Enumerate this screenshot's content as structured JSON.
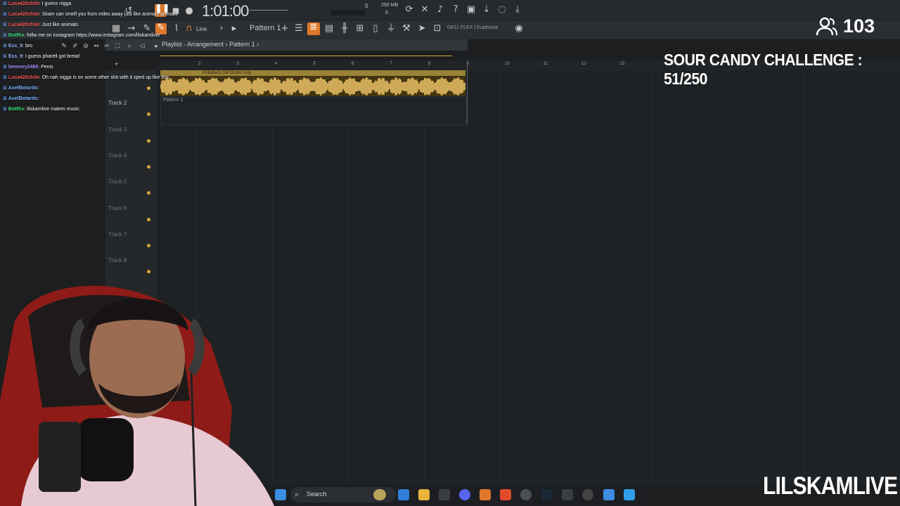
{
  "toolbar": {
    "time": "1:01:00",
    "memory": "250 MB",
    "memory_sub": "0",
    "counter_left": "0",
    "tool_line": "Line",
    "pattern": "Pattern 1",
    "plugin_info": "09/11  FLEX | Euphonia"
  },
  "playlist": {
    "title": "Playlist - Arrangement",
    "breadcrumb_sep": "›",
    "pattern_crumb": "Pattern 1",
    "ruler": [
      "2",
      "3",
      "4",
      "5",
      "6",
      "7",
      "8",
      "9",
      "10",
      "11",
      "12",
      "13"
    ],
    "tracks": [
      {
        "label": ""
      },
      {
        "label": "Track 2"
      },
      {
        "label": "Track 3"
      },
      {
        "label": "Track 4"
      },
      {
        "label": "Track 5"
      },
      {
        "label": "Track 6"
      },
      {
        "label": "Track 7"
      },
      {
        "label": "Track 8"
      }
    ],
    "audio_clip_name": "Hollaback Girl Drums only",
    "pattern_clip_name": "Pattern 1"
  },
  "chat": [
    {
      "user": "Luca420chile",
      "msg": ": I guess nigga",
      "color": "#ff5a5a"
    },
    {
      "user": "Luca420chile",
      "msg": ": Skam can smell you from miles away just like animals animals",
      "color": "#ff5a5a"
    },
    {
      "user": "Luca420chile",
      "msg": ": Just like animals",
      "color": "#ff5a5a"
    },
    {
      "user": "BotRix",
      "msg": ": follw me on instagram https://www.instagram.com/lilskamlive/",
      "color": "#3fe27c"
    },
    {
      "user": "Ess_9",
      "msg": ": bro",
      "color": "#9fb4ff"
    },
    {
      "user": "Ess_9",
      "msg": ": I guess pharell got bread",
      "color": "#9fb4ff"
    },
    {
      "user": "bmoney2486",
      "msg": ": Penis",
      "color": "#b08cff"
    },
    {
      "user": "Luca420chile",
      "msg": ": Oh nah nigga is on some other shit with it sped up like this",
      "color": "#ff5a5a"
    },
    {
      "user": "AxelBotardo",
      "msg": ":",
      "color": "#7ab6ff"
    },
    {
      "user": "AxelBotardo",
      "msg": ":",
      "color": "#7ab6ff"
    },
    {
      "user": "BotRix",
      "msg": ": lilskamlive makes music",
      "color": "#3fe27c"
    }
  ],
  "overlay": {
    "viewers": "103",
    "challenge": "SOUR CANDY CHALLENGE : 51/250",
    "brand": "LILSKAMLIVE"
  },
  "taskbar": {
    "search_placeholder": "Search"
  }
}
